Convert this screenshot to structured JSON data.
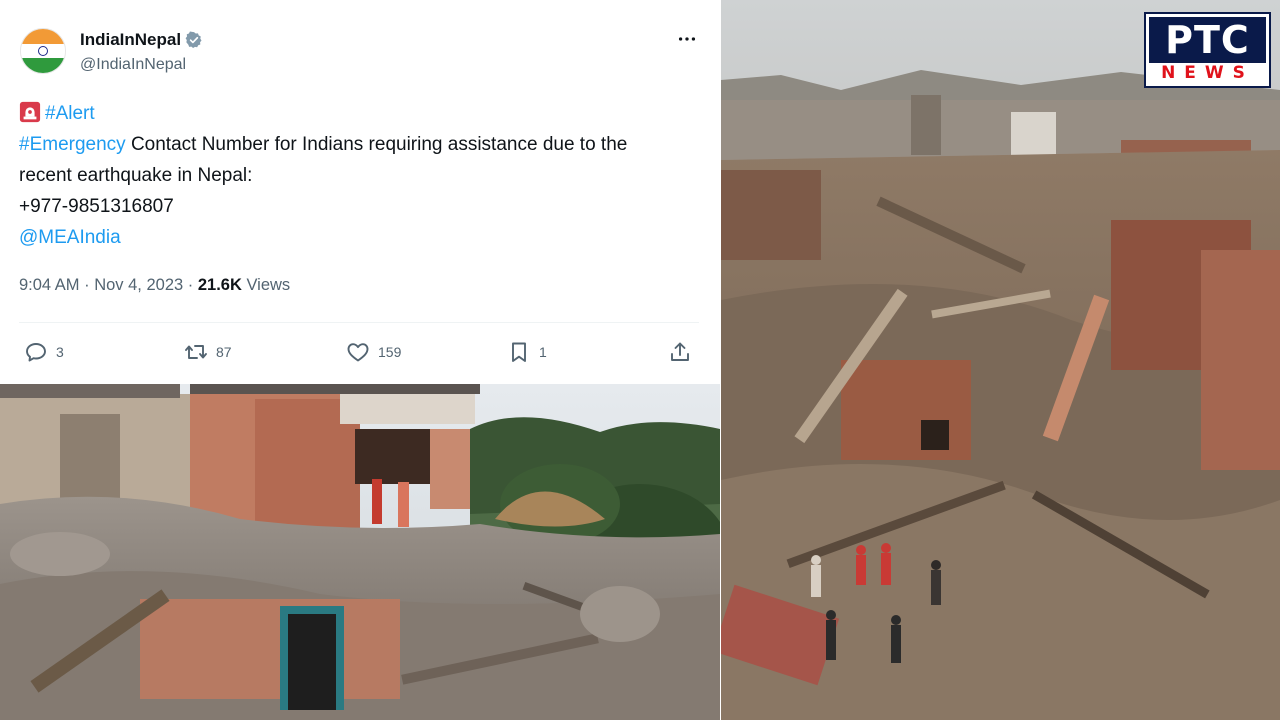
{
  "tweet": {
    "display_name": "IndiaInNepal",
    "handle": "@IndiaInNepal",
    "tag_alert": "#Alert",
    "tag_emergency": "#Emergency",
    "body_line1_rest": " Contact Number for Indians requiring  assistance due to the",
    "body_line2": "recent earthquake in Nepal:",
    "phone": "+977-9851316807",
    "mention": "@MEAIndia",
    "timestamp": "9:04 AM · Nov 4, 2023 · ",
    "views_count": "21.6K",
    "views_label": " Views",
    "replies": "3",
    "reposts": "87",
    "likes": "159",
    "bookmarks": "1"
  },
  "logo": {
    "line1": "PTC",
    "line2": "NEWS"
  },
  "colors": {
    "link": "#1d9bf0",
    "text": "#0f1419",
    "muted": "#536471",
    "logo_navy": "#0a1a4a",
    "logo_red": "#e0121b",
    "flag_saffron": "#f29a36",
    "flag_green": "#2f9a3d"
  },
  "icons": [
    "verified-icon",
    "more-icon",
    "siren-icon",
    "reply-icon",
    "repost-icon",
    "like-icon",
    "bookmark-icon",
    "share-icon"
  ]
}
